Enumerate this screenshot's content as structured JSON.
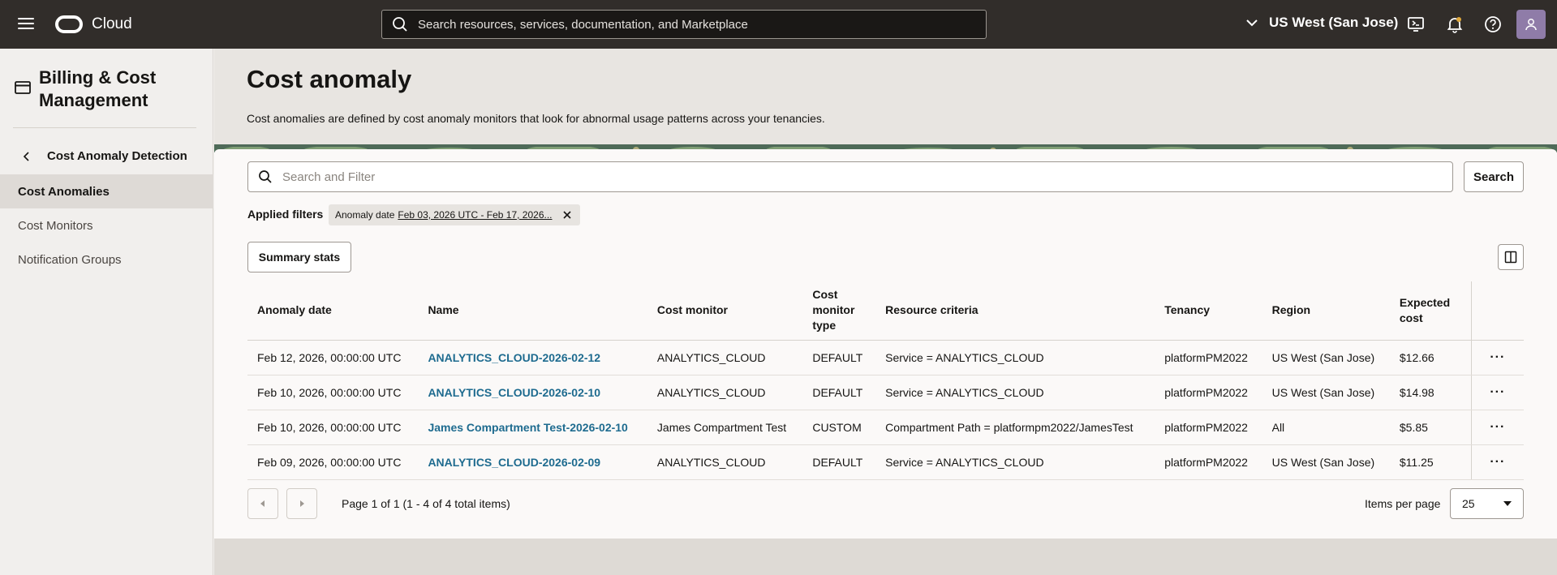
{
  "topbar": {
    "brand": "Cloud",
    "search_placeholder": "Search resources, services, documentation, and Marketplace",
    "region": "US West (San Jose)"
  },
  "sidebar": {
    "title": "Billing & Cost Management",
    "back_label": "Cost Anomaly Detection",
    "items": [
      {
        "label": "Cost Anomalies",
        "active": true
      },
      {
        "label": "Cost Monitors",
        "active": false
      },
      {
        "label": "Notification Groups",
        "active": false
      }
    ]
  },
  "header": {
    "title": "Cost anomaly",
    "description": "Cost anomalies are defined by cost anomaly monitors that look for abnormal usage patterns across your tenancies."
  },
  "filters": {
    "search_placeholder": "Search and Filter",
    "search_button": "Search",
    "applied_label": "Applied filters",
    "chip_key": "Anomaly date",
    "chip_value": "Feb 03, 2026 UTC - Feb 17, 2026..."
  },
  "summary_button": "Summary stats",
  "table": {
    "columns": [
      "Anomaly date",
      "Name",
      "Cost monitor",
      "Cost monitor type",
      "Resource criteria",
      "Tenancy",
      "Region",
      "Expected cost"
    ],
    "rows": [
      {
        "date": "Feb 12, 2026, 00:00:00 UTC",
        "name": "ANALYTICS_CLOUD-2026-02-12",
        "monitor": "ANALYTICS_CLOUD",
        "type": "DEFAULT",
        "criteria": "Service = ANALYTICS_CLOUD",
        "tenancy": "platformPM2022",
        "region": "US West (San Jose)",
        "cost": "$12.66"
      },
      {
        "date": "Feb 10, 2026, 00:00:00 UTC",
        "name": "ANALYTICS_CLOUD-2026-02-10",
        "monitor": "ANALYTICS_CLOUD",
        "type": "DEFAULT",
        "criteria": "Service = ANALYTICS_CLOUD",
        "tenancy": "platformPM2022",
        "region": "US West (San Jose)",
        "cost": "$14.98"
      },
      {
        "date": "Feb 10, 2026, 00:00:00 UTC",
        "name": "James Compartment Test-2026-02-10",
        "monitor": "James Compartment Test",
        "type": "CUSTOM",
        "criteria": "Compartment Path = platformpm2022/JamesTest",
        "tenancy": "platformPM2022",
        "region": "All",
        "cost": "$5.85"
      },
      {
        "date": "Feb 09, 2026, 00:00:00 UTC",
        "name": "ANALYTICS_CLOUD-2026-02-09",
        "monitor": "ANALYTICS_CLOUD",
        "type": "DEFAULT",
        "criteria": "Service = ANALYTICS_CLOUD",
        "tenancy": "platformPM2022",
        "region": "US West (San Jose)",
        "cost": "$11.25"
      }
    ]
  },
  "pagination": {
    "text": "Page 1 of 1 (1 - 4 of 4 total items)",
    "items_per_page_label": "Items per page",
    "items_per_page": "25"
  },
  "icons": {
    "menu": "hamburger-icon",
    "search": "search-icon",
    "region_chevron": "chevron-down-icon",
    "cloud_shell": "cloud-shell-icon",
    "notifications": "bell-icon",
    "help": "help-icon",
    "profile": "user-icon",
    "sidebar_title": "billing-card-icon",
    "back": "chevron-left-icon",
    "chip_remove": "close-icon",
    "columns": "columns-icon",
    "row_actions": "more-actions-icon",
    "prev_page": "chevron-left-icon",
    "next_page": "chevron-right-icon",
    "select_caret": "caret-down-icon"
  }
}
